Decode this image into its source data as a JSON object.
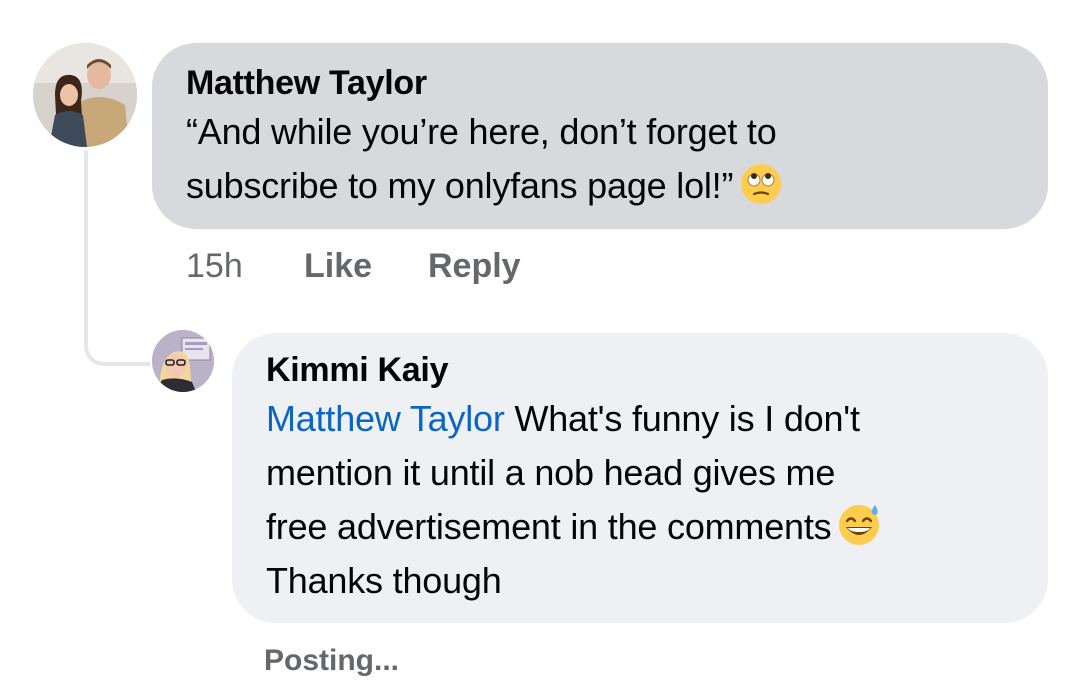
{
  "comments": [
    {
      "author": "Matthew Taylor",
      "text_line1": "“And while you’re here, don’t forget to",
      "text_line2": "subscribe to my onlyfans page lol!”",
      "emoji": "eye-roll-emoji",
      "time": "15h",
      "like_label": "Like",
      "reply_label": "Reply"
    }
  ],
  "reply": {
    "author": "Kimmi Kaiy",
    "mention": "Matthew Taylor",
    "text_line1": " What's funny is I don't",
    "text_line2": "mention it until a nob head gives me",
    "text_line3": "free advertisement in the comments",
    "text_line4": "Thanks though",
    "emoji": "grinning-sweat-emoji",
    "status": "Posting..."
  },
  "colors": {
    "bubble_main": "#d8d9dc",
    "bubble_reply": "#eef0f3",
    "mention": "#0a66c2",
    "meta_text": "#65676b"
  }
}
